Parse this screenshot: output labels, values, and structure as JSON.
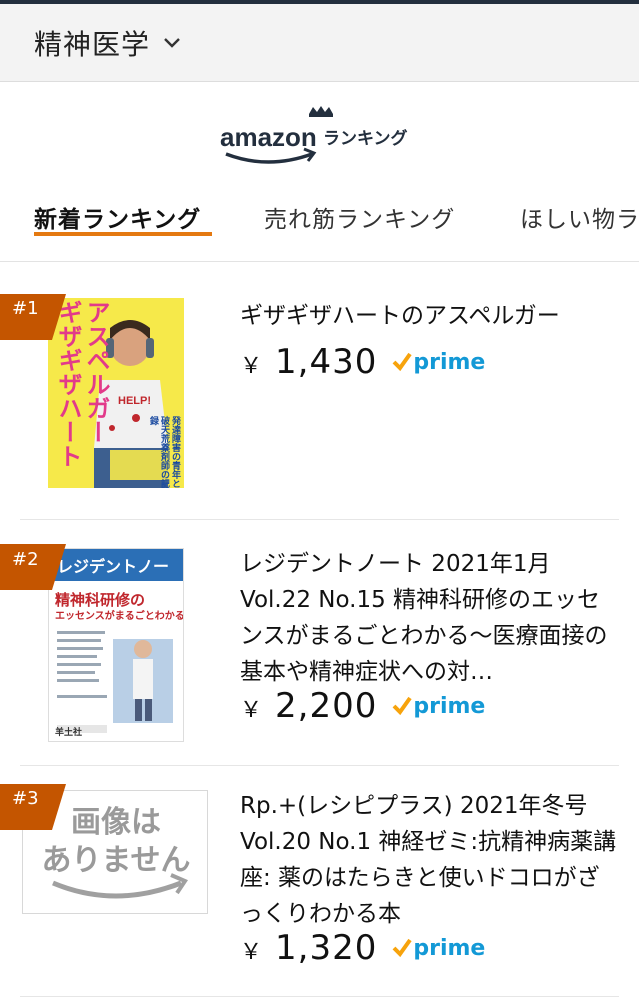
{
  "header": {
    "category": "精神医学"
  },
  "logo": {
    "amazon": "amazon",
    "ranking": "ランキング"
  },
  "tabs": [
    {
      "label": "新着ランキング"
    },
    {
      "label": "売れ筋ランキング"
    },
    {
      "label": "ほしい物ラ"
    }
  ],
  "items": [
    {
      "rank": "#1",
      "title": "ギザギザハートのアスペルガー",
      "price": "1,430",
      "currency": "￥",
      "prime": "prime",
      "cover": {
        "vertical_title_1": "ギザギザハートの",
        "vertical_title_2": "アスペルガー",
        "subtitle": "発達障害の青年と破天荒薬剤師の記録"
      }
    },
    {
      "rank": "#2",
      "title": "レジデントノート 2021年1月 Vol.22 No.15 精神科研修のエッセンスがまるごとわかる〜医療面接の基本や精神症状への対…",
      "price": "2,200",
      "currency": "￥",
      "prime": "prime",
      "cover": {
        "masthead": "レジデントノート",
        "headline1": "精神科研修の",
        "headline2": "エッセンスがまるごとわかる",
        "publisher": "羊土社"
      }
    },
    {
      "rank": "#3",
      "title": "Rp.+(レシピプラス) 2021年冬号 Vol.20 No.1 神経ゼミ:抗精神病薬講座: 薬のはたらきと使いドコロがざっくりわかる本",
      "price": "1,320",
      "currency": "￥",
      "prime": "prime",
      "cover": {
        "placeholder_line1": "画像は",
        "placeholder_line2": "ありません"
      }
    }
  ],
  "colors": {
    "accent": "#e47911",
    "rank_badge": "#c45500",
    "prime_blue": "#1399d6",
    "prime_check": "#f7a30c"
  }
}
